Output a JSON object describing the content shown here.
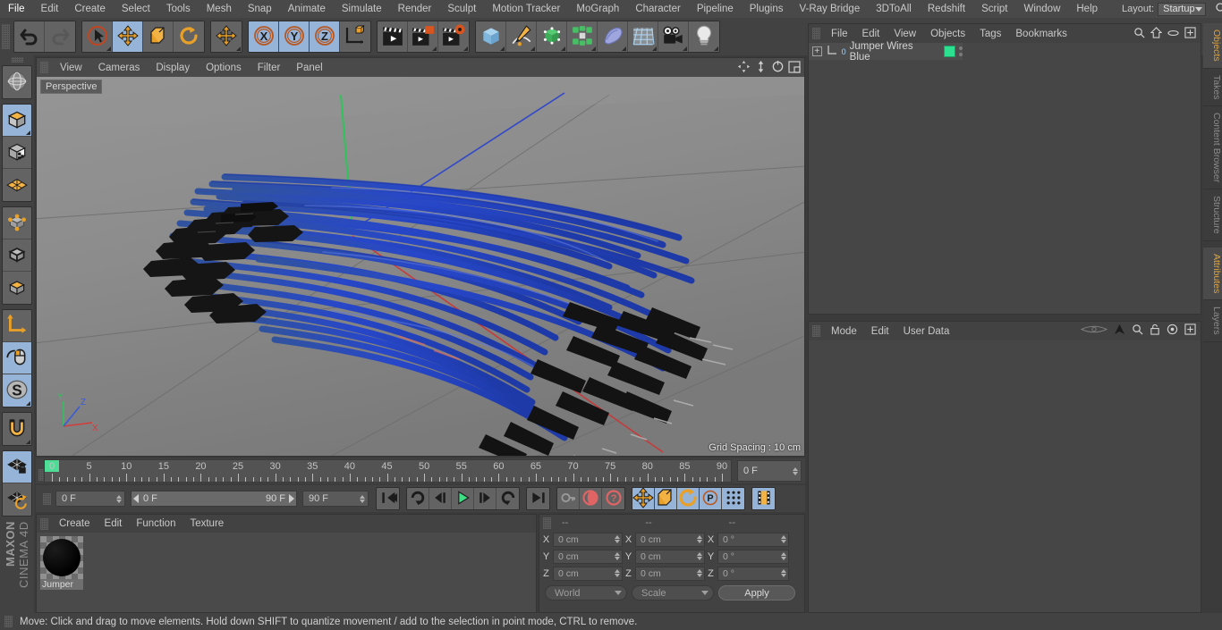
{
  "app": {
    "name": "Cinema 4D",
    "brand_top": "MAXON",
    "brand_bottom": "CINEMA 4D"
  },
  "menubar": {
    "items": [
      "File",
      "Edit",
      "Create",
      "Select",
      "Tools",
      "Mesh",
      "Snap",
      "Animate",
      "Simulate",
      "Render",
      "Sculpt",
      "Motion Tracker",
      "MoGraph",
      "Character",
      "Pipeline",
      "Plugins",
      "V-Ray Bridge",
      "3DToAll",
      "Redshift",
      "Script",
      "Window",
      "Help"
    ],
    "layout_label": "Layout:",
    "layout_value": "Startup",
    "search_icon": "search-icon"
  },
  "toolbar": {
    "groups": [
      {
        "name": "undo-redo",
        "buttons": [
          {
            "name": "undo-button",
            "icon": "undo-arrow-icon",
            "active": false,
            "corner": false
          },
          {
            "name": "redo-button",
            "icon": "redo-arrow-icon",
            "active": false,
            "corner": false
          }
        ]
      },
      {
        "name": "transform-tools",
        "buttons": [
          {
            "name": "live-selection-tool",
            "icon": "cursor-circle-icon",
            "active": false,
            "corner": true
          },
          {
            "name": "move-tool",
            "icon": "move-arrows-icon",
            "active": true,
            "corner": false
          },
          {
            "name": "scale-tool",
            "icon": "scale-box-icon",
            "active": false,
            "corner": false
          },
          {
            "name": "rotate-tool",
            "icon": "rotate-circle-icon",
            "active": false,
            "corner": false
          }
        ]
      },
      {
        "name": "dynamic-place-tool",
        "buttons": [
          {
            "name": "dynamic-place-button",
            "icon": "move-arrows-icon",
            "active": false,
            "corner": true
          }
        ]
      },
      {
        "name": "axis-locks",
        "buttons": [
          {
            "name": "lock-x-axis",
            "icon": "x-axis-icon",
            "label": "X",
            "active": true,
            "corner": false
          },
          {
            "name": "lock-y-axis",
            "icon": "y-axis-icon",
            "label": "Y",
            "active": true,
            "corner": false
          },
          {
            "name": "lock-z-axis",
            "icon": "z-axis-icon",
            "label": "Z",
            "active": true,
            "corner": false
          },
          {
            "name": "world-object-coordinates",
            "icon": "world-axis-cube-icon",
            "active": false,
            "corner": false
          }
        ]
      },
      {
        "name": "render-tools",
        "buttons": [
          {
            "name": "render-view-button",
            "icon": "clapboard-icon",
            "active": false,
            "corner": false
          },
          {
            "name": "render-to-picture-viewer-button",
            "icon": "clapboard-picture-icon",
            "active": false,
            "corner": true
          },
          {
            "name": "render-settings-button",
            "icon": "clapboard-gear-icon",
            "active": false,
            "corner": true
          }
        ]
      },
      {
        "name": "create-objects",
        "buttons": [
          {
            "name": "add-cube-button",
            "icon": "blue-cube-icon",
            "active": false,
            "corner": true
          },
          {
            "name": "add-spline-button",
            "icon": "pen-spline-icon",
            "active": false,
            "corner": true
          },
          {
            "name": "add-nurbs-button",
            "icon": "green-cube-generator-icon",
            "active": false,
            "corner": true
          },
          {
            "name": "add-array-button",
            "icon": "green-array-icon",
            "active": false,
            "corner": true
          },
          {
            "name": "add-deformer-button",
            "icon": "bend-deformer-icon",
            "active": false,
            "corner": true
          },
          {
            "name": "add-scene-object-button",
            "icon": "floor-grid-icon",
            "active": false,
            "corner": true
          },
          {
            "name": "add-camera-button",
            "icon": "camera-icon",
            "active": false,
            "corner": true
          },
          {
            "name": "add-light-button",
            "icon": "light-bulb-icon",
            "active": false,
            "corner": true
          }
        ]
      }
    ]
  },
  "left_toolbar": {
    "groups": [
      {
        "name": "undo-view-group",
        "buttons": [
          {
            "name": "undo-view-button",
            "icon": "globe-sphere-icon",
            "active": false,
            "corner": false
          }
        ]
      },
      {
        "name": "mode-group",
        "buttons": [
          {
            "name": "model-mode-button",
            "icon": "orange-cube-icon",
            "active": true,
            "corner": true
          },
          {
            "name": "texture-mode-button",
            "icon": "checker-cube-icon",
            "active": false,
            "corner": false
          },
          {
            "name": "workplane-mode-button",
            "icon": "orange-lattice-icon",
            "active": false,
            "corner": false
          }
        ]
      },
      {
        "name": "component-group",
        "buttons": [
          {
            "name": "points-mode-button",
            "icon": "cube-points-icon",
            "active": false,
            "corner": false
          },
          {
            "name": "edges-mode-button",
            "icon": "cube-edges-icon",
            "active": false,
            "corner": false
          },
          {
            "name": "polygons-mode-button",
            "icon": "cube-polygon-icon",
            "active": false,
            "corner": false
          }
        ]
      },
      {
        "name": "axis-group",
        "buttons": [
          {
            "name": "enable-axis-button",
            "icon": "axis-L-icon",
            "active": false,
            "corner": false
          },
          {
            "name": "viewport-solo-button",
            "icon": "mouse-icon",
            "active": true,
            "corner": false
          },
          {
            "name": "enable-snapping-button",
            "icon": "s-disc-icon",
            "active": true,
            "corner": true
          }
        ]
      },
      {
        "name": "magnet-group",
        "buttons": [
          {
            "name": "magnet-tool-button",
            "icon": "magnet-icon",
            "active": false,
            "corner": true
          }
        ]
      },
      {
        "name": "workplane-group",
        "buttons": [
          {
            "name": "lock-workplane-button",
            "icon": "grid-lock-icon",
            "active": true,
            "corner": false
          },
          {
            "name": "reset-workplane-button",
            "icon": "grid-reset-icon",
            "active": false,
            "corner": false
          }
        ]
      }
    ]
  },
  "viewport": {
    "menu": [
      "View",
      "Cameras",
      "Display",
      "Options",
      "Filter",
      "Panel"
    ],
    "view_label": "Perspective",
    "grid_spacing": "Grid Spacing : 10 cm",
    "corner_icons": [
      "move-view-icon",
      "pan-view-icon",
      "rotate-view-icon",
      "maximize-view-icon"
    ],
    "axis_gizmo": {
      "x": "X",
      "y": "Y",
      "z": "Z"
    },
    "scene": {
      "object_color": "#2b51c4",
      "connector_color": "#1a1a1a"
    }
  },
  "timeline": {
    "ticks": [
      0,
      5,
      10,
      15,
      20,
      25,
      30,
      35,
      40,
      45,
      50,
      55,
      60,
      65,
      70,
      75,
      80,
      85,
      90
    ],
    "playhead_frame": 0,
    "current_frame_field": "0 F"
  },
  "transport": {
    "start_frame": "0 F",
    "range_left": "0 F",
    "range_right": "90 F",
    "end_frame": "90 F",
    "buttons": [
      {
        "name": "go-to-start-button",
        "icon": "skip-back-icon",
        "active": false
      },
      {
        "name": "play-backwards-button",
        "icon": "rewind-loop-icon",
        "active": false
      },
      {
        "name": "previous-frame-button",
        "icon": "step-back-icon",
        "active": false
      },
      {
        "name": "play-button",
        "icon": "play-triangle-icon",
        "active": false
      },
      {
        "name": "next-frame-button",
        "icon": "step-forward-icon",
        "active": false
      },
      {
        "name": "play-forwards-button",
        "icon": "forward-loop-icon",
        "active": false
      },
      {
        "name": "go-to-end-button",
        "icon": "skip-forward-icon",
        "active": false
      },
      {
        "name": "record-active-objects-button",
        "icon": "key-icon",
        "active": false
      },
      {
        "name": "autokeying-button",
        "icon": "red-record-icon",
        "active": false
      },
      {
        "name": "keyframe-selection-button",
        "icon": "red-question-icon",
        "active": false
      },
      {
        "name": "position-key-button",
        "icon": "move-arrows-icon",
        "active": true
      },
      {
        "name": "scale-key-button",
        "icon": "scale-box-icon",
        "active": true
      },
      {
        "name": "rotation-key-button",
        "icon": "rotate-circle-icon",
        "active": true
      },
      {
        "name": "parameter-key-button",
        "icon": "p-circle-icon",
        "active": true
      },
      {
        "name": "point-level-animation-button",
        "icon": "dots-grid-icon",
        "active": true
      },
      {
        "name": "timeline-toggle-button",
        "icon": "filmstrip-icon",
        "active": true
      }
    ]
  },
  "material_manager": {
    "menu": [
      "Create",
      "Edit",
      "Function",
      "Texture"
    ],
    "materials": [
      {
        "name": "Jumper",
        "swatch_color": "#000000"
      }
    ]
  },
  "coordinates": {
    "headers": [
      "--",
      "--",
      "--"
    ],
    "position": {
      "label_x": "X",
      "label_y": "Y",
      "label_z": "Z",
      "x": "0 cm",
      "y": "0 cm",
      "z": "0 cm"
    },
    "size": {
      "label_x": "X",
      "label_y": "Y",
      "label_z": "Z",
      "x": "0 cm",
      "y": "0 cm",
      "z": "0 cm"
    },
    "rotation": {
      "label_x": "X",
      "label_y": "Y",
      "label_z": "Z",
      "x": "0 °",
      "y": "0 °",
      "z": "0 °"
    },
    "coord_system": "World",
    "size_mode": "Scale",
    "apply_label": "Apply"
  },
  "object_manager": {
    "menu": [
      "File",
      "Edit",
      "View",
      "Objects",
      "Tags",
      "Bookmarks"
    ],
    "icons": [
      "search-icon",
      "home-icon",
      "ellipse-icon",
      "plus-box-icon"
    ],
    "rows": [
      {
        "name": "Jumper Wires Blue",
        "layer_badge": "0",
        "tag_color": "#2ce08f"
      }
    ]
  },
  "attribute_manager": {
    "menu": [
      "Mode",
      "Edit",
      "User Data"
    ],
    "icons": [
      "eye-history-icon",
      "arrow-up-icon",
      "search-icon",
      "lock-icon",
      "target-icon",
      "plus-box-icon"
    ]
  },
  "right_tabs": {
    "upper": [
      {
        "label": "Objects",
        "selected": true
      },
      {
        "label": "Takes",
        "selected": false
      },
      {
        "label": "Content Browser",
        "selected": false
      },
      {
        "label": "Structure",
        "selected": false
      }
    ],
    "lower": [
      {
        "label": "Attributes",
        "selected": true
      },
      {
        "label": "Layers",
        "selected": false
      }
    ]
  },
  "statusbar": {
    "text": "Move: Click and drag to move elements. Hold down SHIFT to quantize movement / add to the selection in point mode, CTRL to remove."
  }
}
